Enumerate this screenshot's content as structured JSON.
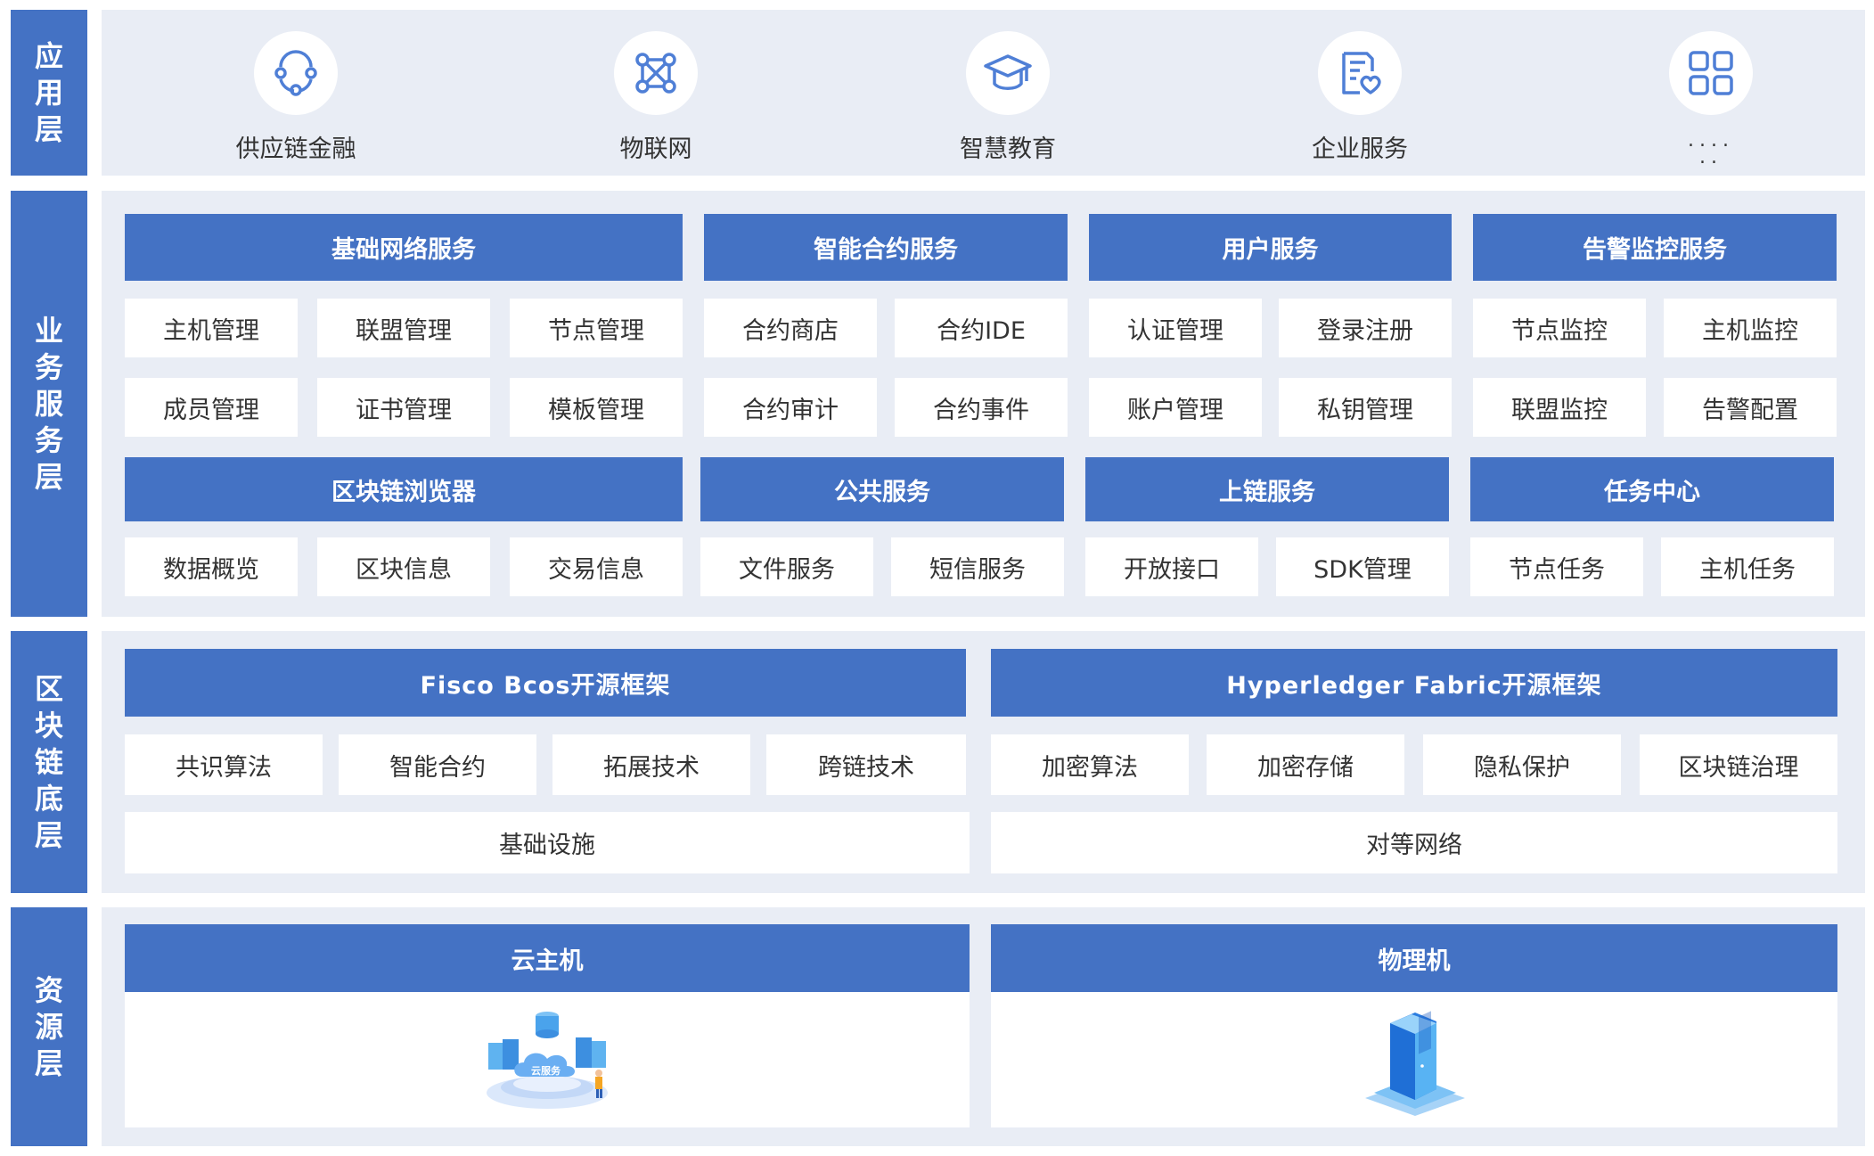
{
  "layers": {
    "application": "应用层",
    "business": "业务服务层",
    "blockchain": "区块链底层",
    "resource": "资源层"
  },
  "apps": [
    {
      "label": "供应链金融",
      "icon": "supply-chain-icon"
    },
    {
      "label": "物联网",
      "icon": "iot-icon"
    },
    {
      "label": "智慧教育",
      "icon": "graduation-cap-icon"
    },
    {
      "label": "企业服务",
      "icon": "enterprise-doc-icon"
    },
    {
      "label": "....",
      "label2": "..",
      "icon": "grid-icon"
    }
  ],
  "business": {
    "groups": [
      {
        "title": "基础网络服务",
        "items": [
          "主机管理",
          "联盟管理",
          "节点管理",
          "成员管理",
          "证书管理",
          "模板管理"
        ]
      },
      {
        "title": "智能合约服务",
        "items": [
          "合约商店",
          "合约IDE",
          "合约审计",
          "合约事件"
        ]
      },
      {
        "title": "用户服务",
        "items": [
          "认证管理",
          "登录注册",
          "账户管理",
          "私钥管理"
        ]
      },
      {
        "title": "告警监控服务",
        "items": [
          "节点监控",
          "主机监控",
          "联盟监控",
          "告警配置"
        ]
      },
      {
        "title": "区块链浏览器",
        "items": [
          "数据概览",
          "区块信息",
          "交易信息"
        ]
      },
      {
        "title": "公共服务",
        "items": [
          "文件服务",
          "短信服务"
        ]
      },
      {
        "title": "上链服务",
        "items": [
          "开放接口",
          "SDK管理"
        ]
      },
      {
        "title": "任务中心",
        "items": [
          "节点任务",
          "主机任务"
        ]
      }
    ]
  },
  "blockchain": {
    "fisco": {
      "title": "Fisco Bcos开源框架",
      "items": [
        "共识算法",
        "智能合约",
        "拓展技术",
        "跨链技术"
      ],
      "base": "基础设施"
    },
    "fabric": {
      "title": "Hyperledger Fabric开源框架",
      "items": [
        "加密算法",
        "加密存储",
        "隐私保护",
        "区块链治理"
      ],
      "base": "对等网络"
    }
  },
  "resource": {
    "cloud": {
      "title": "云主机",
      "image_text": "云服务"
    },
    "physical": {
      "title": "物理机"
    }
  },
  "colors": {
    "primary": "#4472c4",
    "panel": "#e9edf5",
    "text": "#333333",
    "icon": "#4f7fd6"
  }
}
